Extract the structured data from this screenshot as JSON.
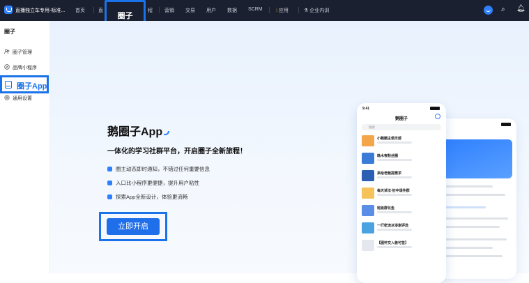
{
  "topbar": {
    "brand": "直播独立车专用-标准...",
    "nav": [
      "首页",
      "直",
      "程",
      "营销",
      "交易",
      "用户",
      "数据",
      "SCRM"
    ],
    "apps": "应用",
    "training": "企业内训",
    "highlight_tab": "圈子"
  },
  "sidebar": {
    "title": "圈子",
    "items": [
      {
        "label": "圈子管理",
        "icon": "people-icon"
      },
      {
        "label": "品牌小程序",
        "icon": "compass-icon"
      },
      {
        "label": "圈子App",
        "icon": "tablet-icon",
        "selected": true
      },
      {
        "label": "通用设置",
        "icon": "gear-icon"
      }
    ]
  },
  "hero": {
    "title": "鹅圈子App",
    "subtitle": "一体化的学习社群平台，开启圈子全新旅程！",
    "features": [
      "圈主动态即时通知，不错过任何重要信息",
      "入口比小程序更便捷，提升用户粘性",
      "探索App全新设计，体验更流畅"
    ],
    "cta": "立即开启"
  },
  "phone": {
    "time": "9:41",
    "title": "鹅圈子",
    "search_placeholder": "搜索",
    "rows": [
      {
        "name": "小鹅圈主俱乐部",
        "color": "#f3a64a"
      },
      {
        "name": "晚木夜粉丝圈",
        "color": "#3b7bd8"
      },
      {
        "name": "来给老鲍提需求",
        "color": "#2b5fb4"
      },
      {
        "name": "每天读法·初中课件群",
        "color": "#f6c35a"
      },
      {
        "name": "班级群化鱼",
        "color": "#5a8ee6"
      },
      {
        "name": "一行密流冰漆谢评选",
        "color": "#4aa3e0"
      },
      {
        "name": "【图怀交入兽可签】",
        "color": "#e4e8ee"
      }
    ]
  }
}
